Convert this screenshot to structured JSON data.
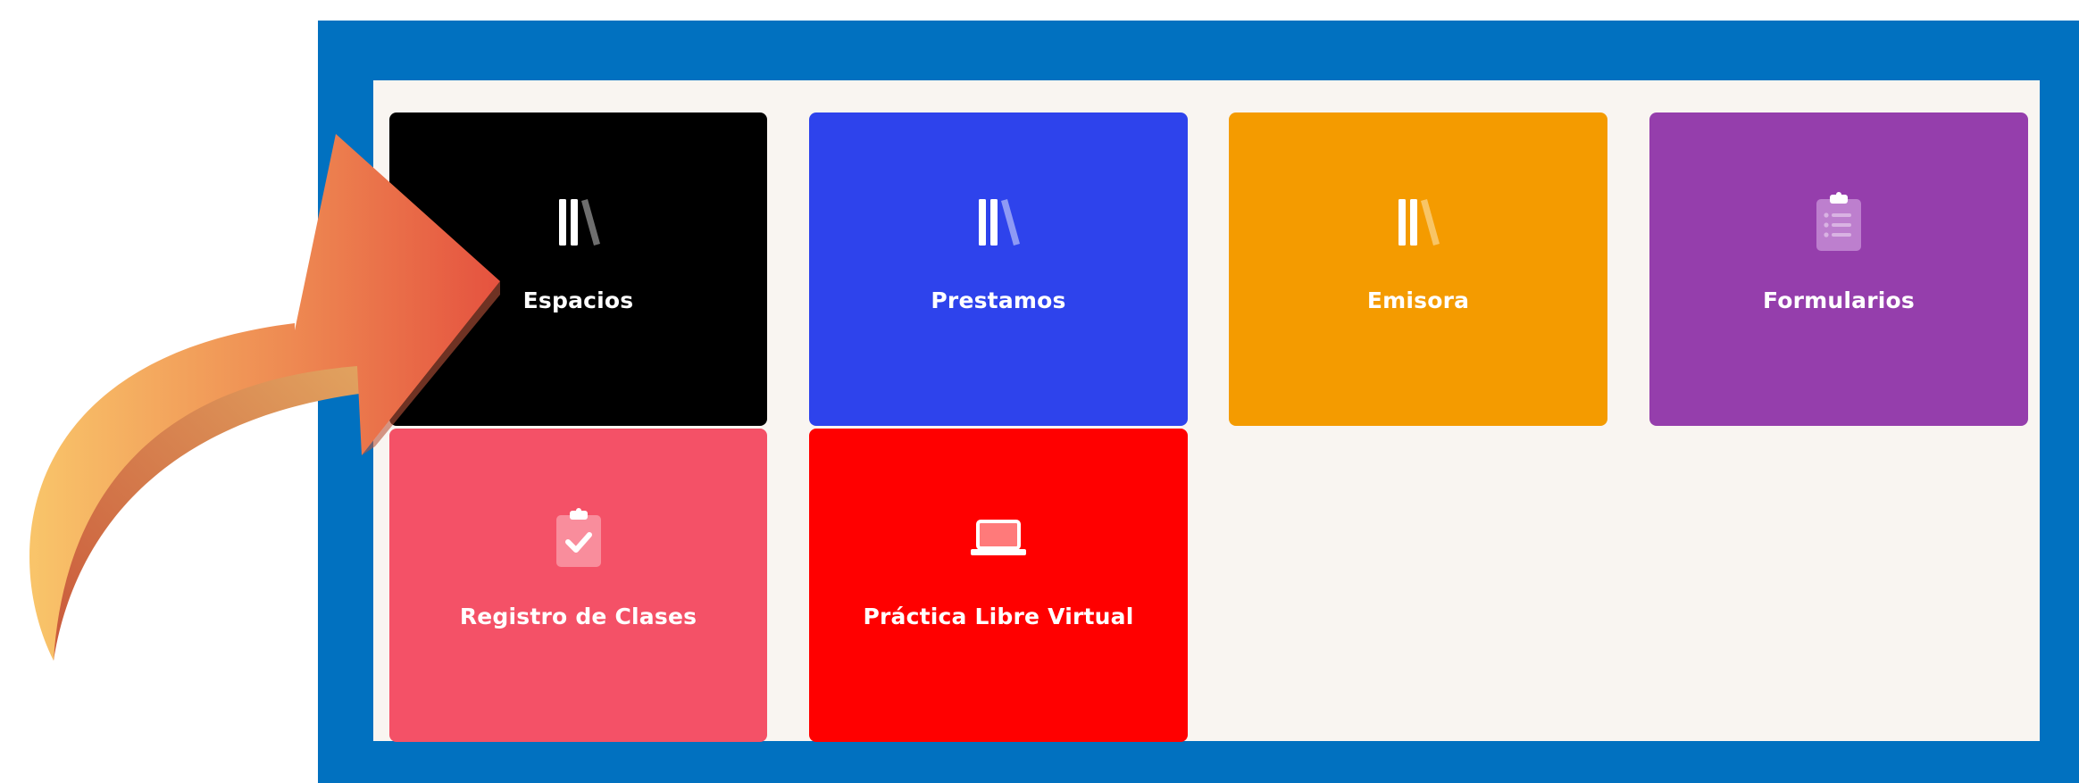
{
  "colors": {
    "frame": "#0171c0",
    "panel": "#f9f5f1",
    "tile_espacios": "#000000",
    "tile_prestamos": "#2e43ec",
    "tile_emisora": "#f49b00",
    "tile_formularios": "#953eac",
    "tile_registro": "#f45167",
    "tile_practica": "#ff0000",
    "arrow_light": "#f9c56a",
    "arrow_dark": "#e5523f"
  },
  "tiles": [
    {
      "label": "Espacios",
      "icon": "books-icon"
    },
    {
      "label": "Prestamos",
      "icon": "books-icon"
    },
    {
      "label": "Emisora",
      "icon": "books-icon"
    },
    {
      "label": "Formularios",
      "icon": "clipboard-list-icon"
    },
    {
      "label": "Registro de Clases",
      "icon": "clipboard-check-icon"
    },
    {
      "label": "Práctica Libre Virtual",
      "icon": "laptop-icon"
    }
  ],
  "annotation": {
    "icon": "curved-arrow-icon"
  }
}
